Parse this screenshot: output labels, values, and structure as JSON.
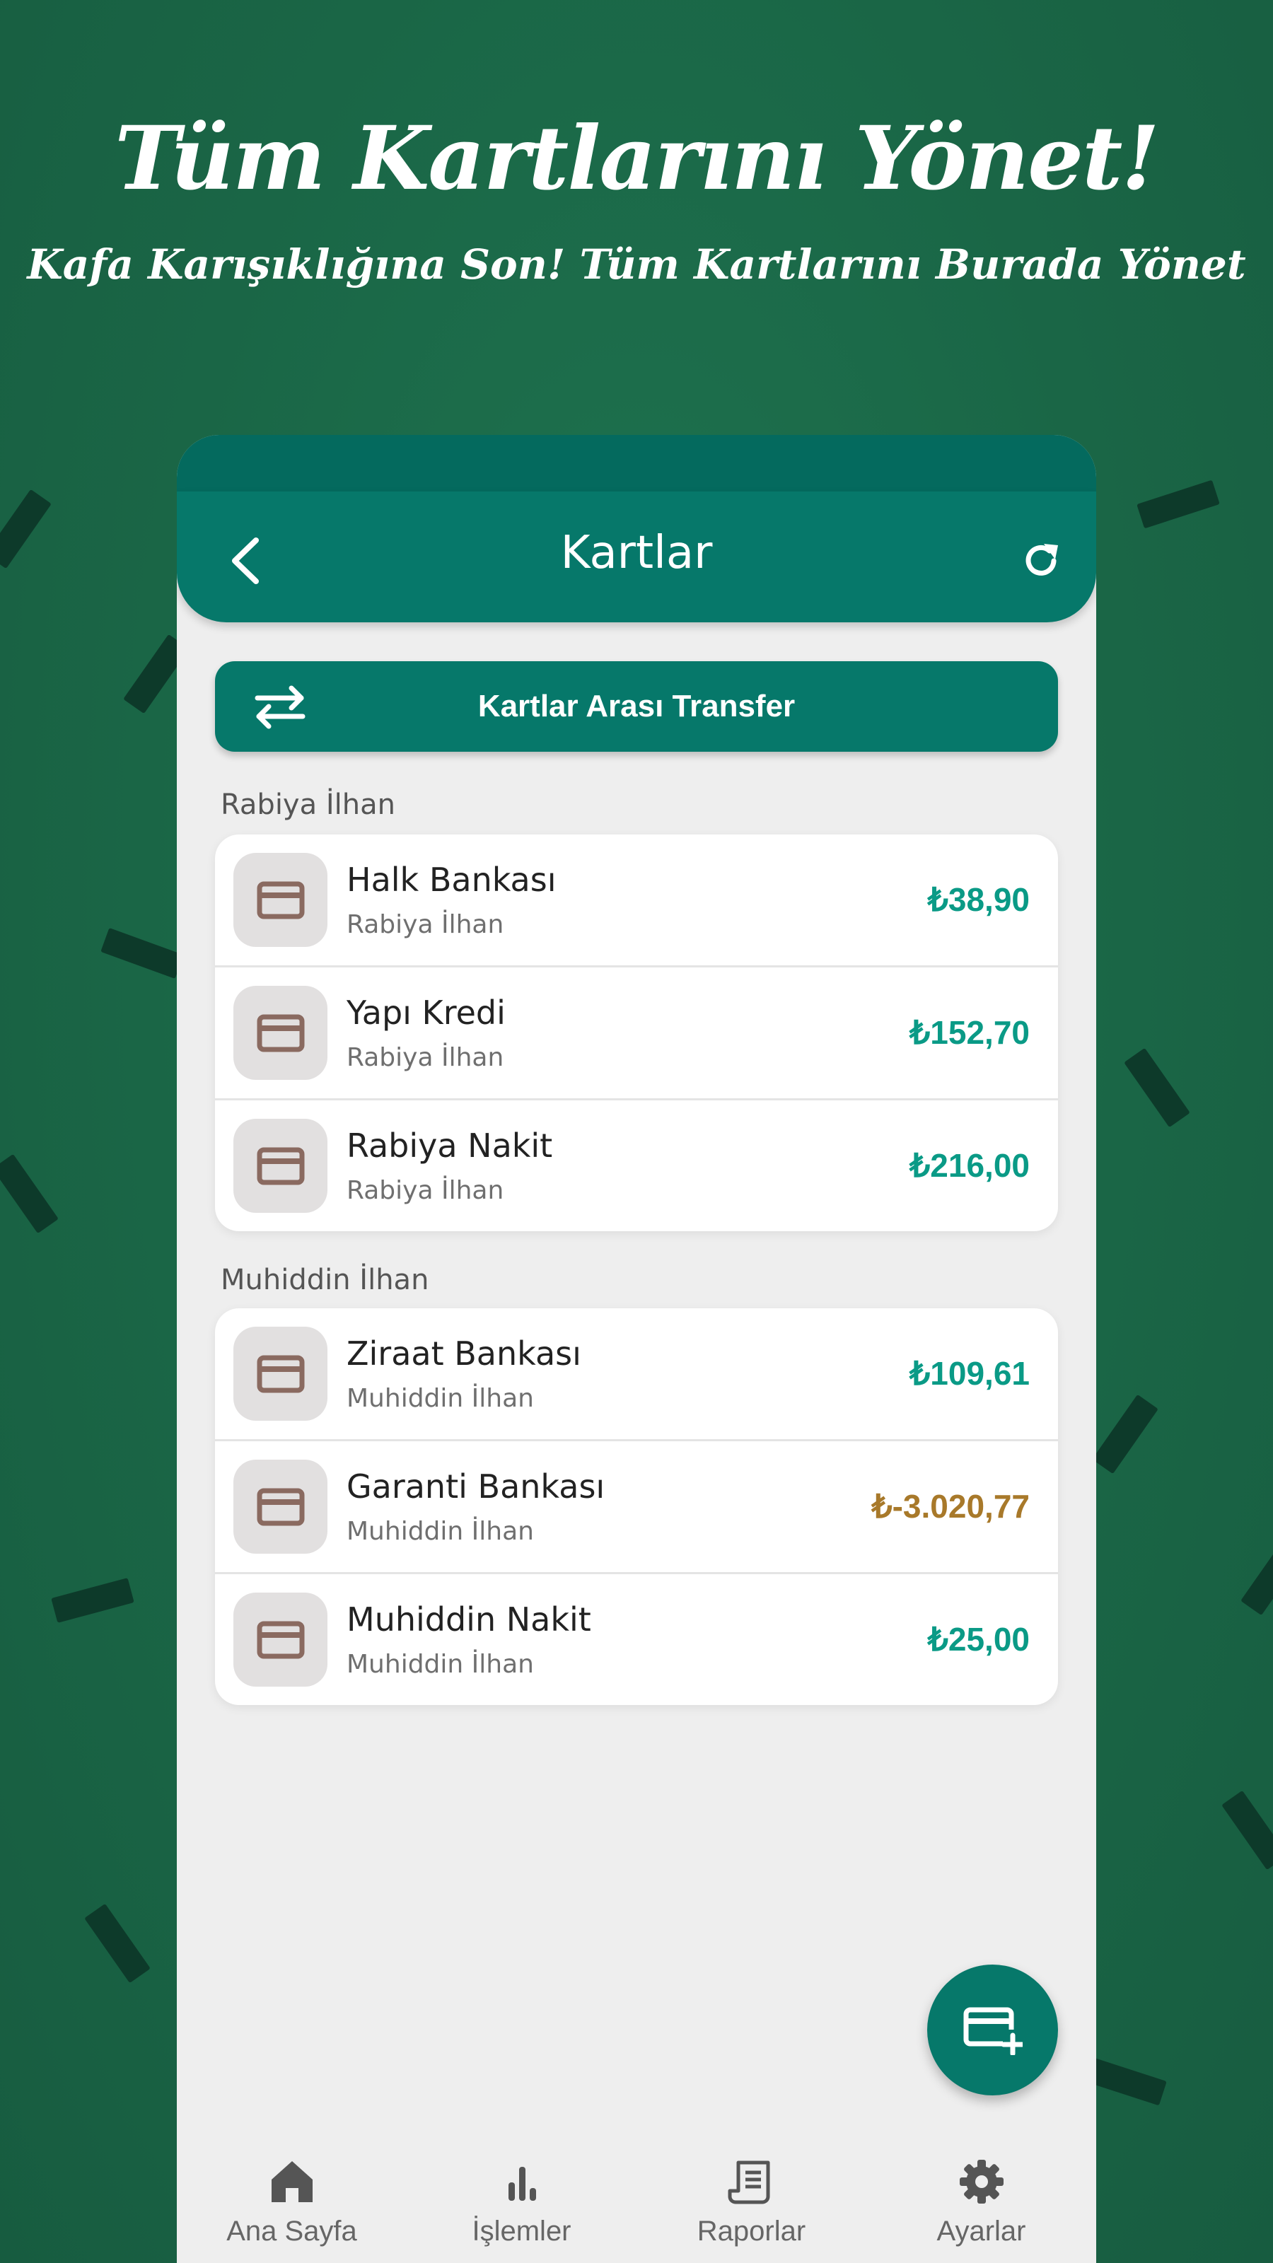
{
  "hero": {
    "title": "Tüm Kartlarını Yönet!",
    "subtitle": "Kafa Karışıklığına Son! Tüm Kartlarını Burada Yönet"
  },
  "appbar": {
    "title": "Kartlar",
    "back_icon": "chevron-left-icon",
    "refresh_icon": "refresh-icon"
  },
  "transfer_button": {
    "label": "Kartlar Arası Transfer",
    "icon": "swap-arrows-icon"
  },
  "groups": [
    {
      "title": "Rabiya İlhan",
      "cards": [
        {
          "name": "Halk Bankası",
          "owner": "Rabiya İlhan",
          "amount": "₺38,90"
        },
        {
          "name": "Yapı Kredi",
          "owner": "Rabiya İlhan",
          "amount": "₺152,70"
        },
        {
          "name": "Rabiya Nakit",
          "owner": "Rabiya İlhan",
          "amount": "₺216,00"
        }
      ]
    },
    {
      "title": "Muhiddin İlhan",
      "cards": [
        {
          "name": "Ziraat Bankası",
          "owner": "Muhiddin İlhan",
          "amount": "₺109,61"
        },
        {
          "name": "Garanti Bankası",
          "owner": "Muhiddin İlhan",
          "amount": "₺-3.020,77"
        },
        {
          "name": "Muhiddin Nakit",
          "owner": "Muhiddin İlhan",
          "amount": "₺25,00"
        }
      ]
    }
  ],
  "fab": {
    "icon": "add-card-icon"
  },
  "bottom_nav": [
    {
      "label": "Ana Sayfa",
      "icon": "home-icon"
    },
    {
      "label": "İşlemler",
      "icon": "bar-chart-icon"
    },
    {
      "label": "Raporlar",
      "icon": "receipt-icon"
    },
    {
      "label": "Ayarlar",
      "icon": "gear-icon"
    }
  ],
  "colors": {
    "background": "#1b6a48",
    "accent": "#06786a",
    "positive_amount": "#0a9a86",
    "negative_amount": "#a8792a",
    "card_icon": "#8a6a60"
  }
}
